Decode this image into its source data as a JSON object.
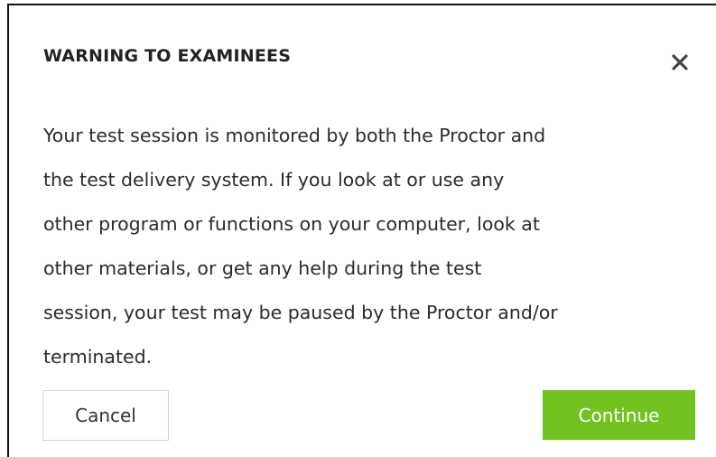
{
  "dialog": {
    "title": "WARNING TO EXAMINEES",
    "close_icon": "close-icon",
    "message_lines": [
      "Your test session is monitored by both the Proctor and",
      "the test delivery system. If you look at or use any",
      "other program or functions on your computer, look at",
      "other materials, or get any help during the test",
      "session, your test may be paused by the Proctor and/or",
      "terminated."
    ],
    "cancel_label": "Cancel",
    "continue_label": "Continue"
  },
  "colors": {
    "continue_button": "#72c322",
    "text": "#2b2b2b",
    "border": "#111111"
  }
}
